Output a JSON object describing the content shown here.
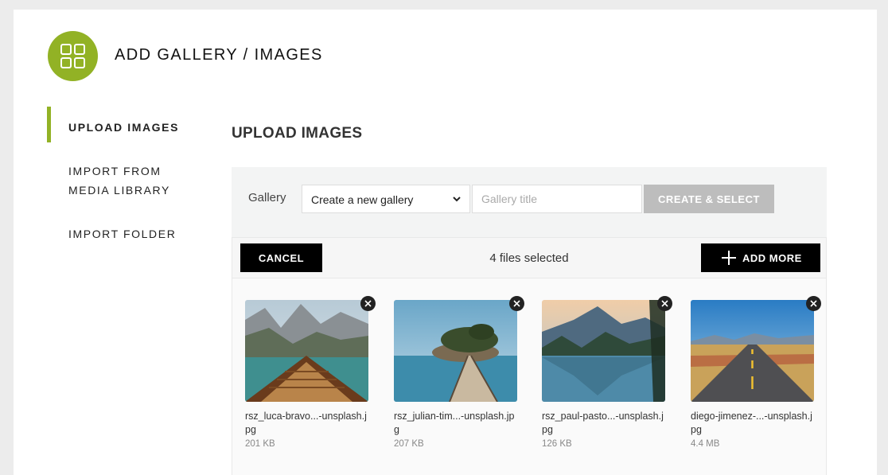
{
  "header": {
    "title": "ADD GALLERY / IMAGES",
    "logo_icon": "grid-icon",
    "accent": "#92b225"
  },
  "sidebar": {
    "items": [
      {
        "label": "UPLOAD IMAGES",
        "active": true
      },
      {
        "label": "IMPORT FROM MEDIA LIBRARY",
        "active": false
      },
      {
        "label": "IMPORT FOLDER",
        "active": false
      }
    ]
  },
  "main": {
    "section_title": "UPLOAD IMAGES",
    "gallery": {
      "label": "Gallery",
      "select_value": "Create a new gallery",
      "title_placeholder": "Gallery title",
      "create_label": "CREATE & SELECT"
    },
    "uploader": {
      "cancel_label": "CANCEL",
      "files_selected": "4 files selected",
      "add_more_label": "ADD MORE",
      "files": [
        {
          "name": "rsz_luca-bravo...-unsplash.jpg",
          "size": "201 KB"
        },
        {
          "name": "rsz_julian-tim...-unsplash.jpg",
          "size": "207 KB"
        },
        {
          "name": "rsz_paul-pasto...-unsplash.jpg",
          "size": "126 KB"
        },
        {
          "name": "diego-jimenez-...-unsplash.jpg",
          "size": "4.4 MB"
        }
      ]
    }
  }
}
